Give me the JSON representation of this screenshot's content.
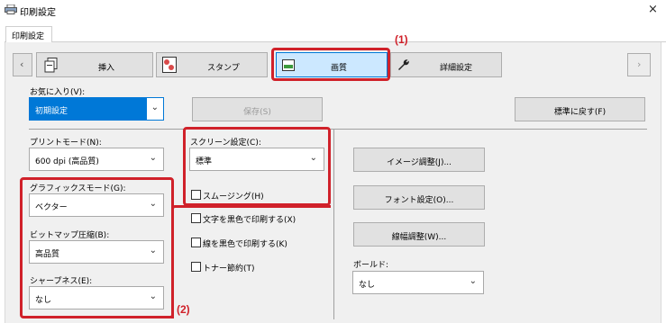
{
  "window": {
    "title": "印刷設定",
    "close_glyph": "×"
  },
  "tab": {
    "label": "印刷設定"
  },
  "nav": {
    "left_arrow": "‹",
    "right_arrow": "›"
  },
  "categories": [
    {
      "label": "挿入"
    },
    {
      "label": "スタンプ"
    },
    {
      "label": "画質"
    },
    {
      "label": "詳細設定"
    }
  ],
  "favorites": {
    "label": "お気に入り(V):",
    "value": "初期設定"
  },
  "buttons": {
    "save": "保存(S)",
    "reset": "標準に戻す(F)",
    "image_adjust": "イメージ調整(J)...",
    "font_settings": "フォント設定(O)...",
    "line_width": "線幅調整(W)..."
  },
  "print_mode": {
    "label": "プリントモード(N):",
    "value": "600 dpi (高品質)"
  },
  "screen": {
    "label": "スクリーン設定(C):",
    "value": "標準"
  },
  "smoothing": {
    "label": "スムージング(H)"
  },
  "graphics_mode": {
    "label": "グラフィックスモード(G):",
    "value": "ベクター"
  },
  "bitmap": {
    "label": "ビットマップ圧縮(B):",
    "value": "高品質"
  },
  "sharpness": {
    "label": "シャープネス(E):",
    "value": "なし"
  },
  "checks": [
    {
      "label": "文字を黒色で印刷する(X)"
    },
    {
      "label": "線を黒色で印刷する(K)"
    },
    {
      "label": "トナー節約(T)"
    }
  ],
  "bold": {
    "label": "ボールド:",
    "value": "なし"
  },
  "annotations": {
    "one": "(1)",
    "two": "(2)"
  },
  "colors": {
    "highlight": "#d0212a",
    "selected": "#0078d7"
  }
}
